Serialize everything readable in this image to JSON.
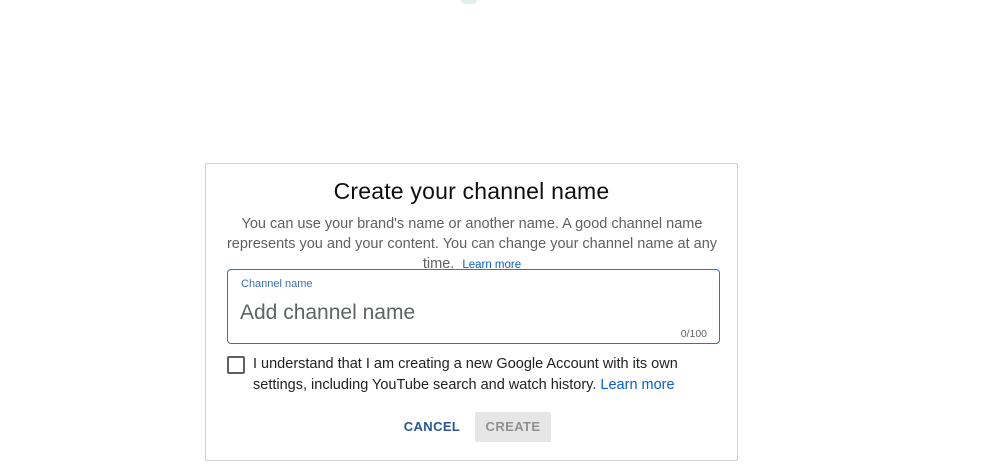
{
  "dialog": {
    "title": "Create your channel name",
    "description": "You can use your brand's name or another name. A good channel name represents you and your content. You can change your channel name at any time.",
    "description_link": "Learn more",
    "field": {
      "label": "Channel name",
      "placeholder": "Add channel name",
      "value": "",
      "char_count": "0/100"
    },
    "checkbox": {
      "checked": false,
      "text": "I understand that I am creating a new Google Account with its own settings, including YouTube search and watch history.",
      "link": "Learn more"
    },
    "buttons": {
      "cancel": "CANCEL",
      "create": "CREATE"
    }
  },
  "colors": {
    "accent_blue": "#065fd4",
    "field_border": "#3a6fb8",
    "disabled_button_bg": "#e6e6e6"
  }
}
